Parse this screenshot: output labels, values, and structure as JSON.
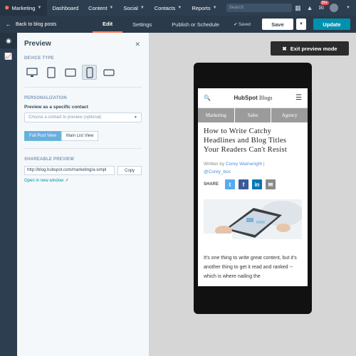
{
  "topnav": {
    "brand": "Marketing",
    "items": [
      "Dashboard",
      "Content",
      "Social",
      "Contacts",
      "Reports"
    ],
    "search_placeholder": "Search",
    "notification_count": "99+"
  },
  "subbar": {
    "back_label": "Back to blog posts",
    "tabs": [
      "Edit",
      "Settings",
      "Publish or Schedule"
    ],
    "saved_label": "Saved",
    "save_label": "Save",
    "update_label": "Update"
  },
  "panel": {
    "title": "Preview",
    "device_type_label": "DEVICE TYPE",
    "personalization_label": "PERSONALIZATION",
    "preview_as_label": "Preview as a specific contact",
    "contact_placeholder": "Choose a contact to preview (optional)",
    "full_post_view": "Full Post View",
    "main_list_view": "Main List View",
    "shareable_label": "SHAREABLE PREVIEW",
    "url_value": "http://blog.hubspot.com/marketing/a-simpl",
    "copy_label": "Copy",
    "new_window_label": "Open in new window"
  },
  "canvas": {
    "exit_label": "Exit preview mode"
  },
  "blog": {
    "logo_prefix": "HubSpot",
    "logo_suffix": "Blogs",
    "tabs": [
      "Marketing",
      "Sales",
      "Agency"
    ],
    "title": "How to Write Catchy Headlines and Blog Titles Your Readers Can't Resist",
    "written_by": "Written by",
    "author": "Corey Wainwright",
    "author_sep": "|",
    "handle": "@Corey_bos",
    "share_label": "SHARE",
    "body": "It's one thing to write great content, but it's another thing to get it read and ranked -- which is where nailing the"
  },
  "colors": {
    "nav_bg": "#2d3e50",
    "accent": "#ff7a59",
    "update_btn": "#0091ae",
    "twitter": "#55acee",
    "facebook": "#3b5998",
    "linkedin": "#0077b5",
    "email": "#8a8a8a"
  }
}
